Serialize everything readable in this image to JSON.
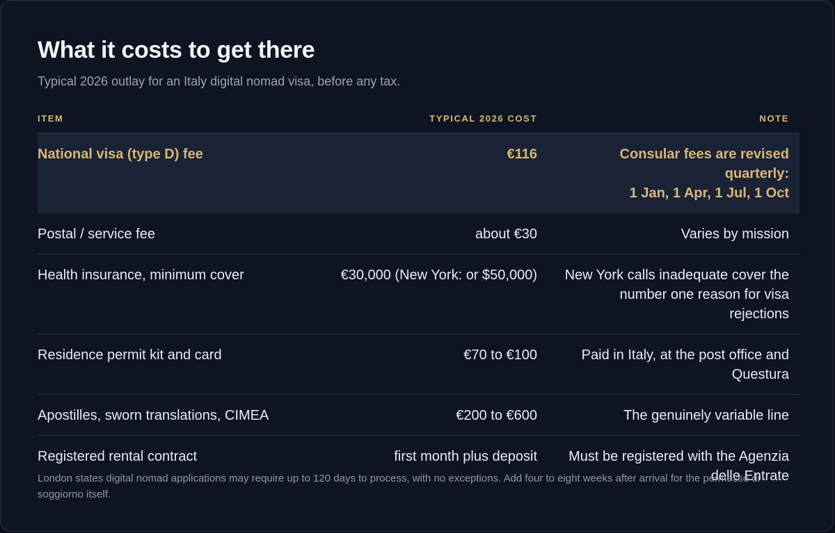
{
  "header": {
    "title": "What it costs to get there",
    "subtitle": "Typical 2026 outlay for an Italy digital nomad visa, before any tax."
  },
  "table": {
    "columns": [
      "ITEM",
      "TYPICAL 2026 COST",
      "NOTE"
    ],
    "rows": [
      {
        "item": "National visa (type D) fee",
        "cost": "€116",
        "note_line1": "Consular fees are revised quarterly:",
        "note_line2": "1 Jan, 1 Apr, 1 Jul, 1 Oct",
        "highlighted": true
      },
      {
        "item": "Postal / service fee",
        "cost": "about €30",
        "note_line1": "Varies by mission",
        "note_line2": ""
      },
      {
        "item": "Health insurance, minimum cover",
        "cost": "€30,000 (New York: or $50,000)",
        "note_line1": "New York calls inadequate cover the",
        "note_line2": "number one reason for visa rejections"
      },
      {
        "item": "Residence permit kit and card",
        "cost": "€70 to €100",
        "note_line1": "Paid in Italy, at the post office and",
        "note_line2": "Questura"
      },
      {
        "item": "Apostilles, sworn translations, CIMEA",
        "cost": "€200 to €600",
        "note_line1": "The genuinely variable line",
        "note_line2": ""
      },
      {
        "item": "Registered rental contract",
        "cost": "first month plus deposit",
        "note_line1": "Must be registered with the Agenzia",
        "note_line2": "delle Entrate"
      }
    ]
  },
  "footnote": "London states digital nomad applications may require up to 120 days to process, with no exceptions. Add four to eight weeks after arrival for the permesso di soggiorno itself.",
  "colors": {
    "background": "#0f1422",
    "accent": "#d9b676",
    "highlight_row": "#1a2335"
  }
}
